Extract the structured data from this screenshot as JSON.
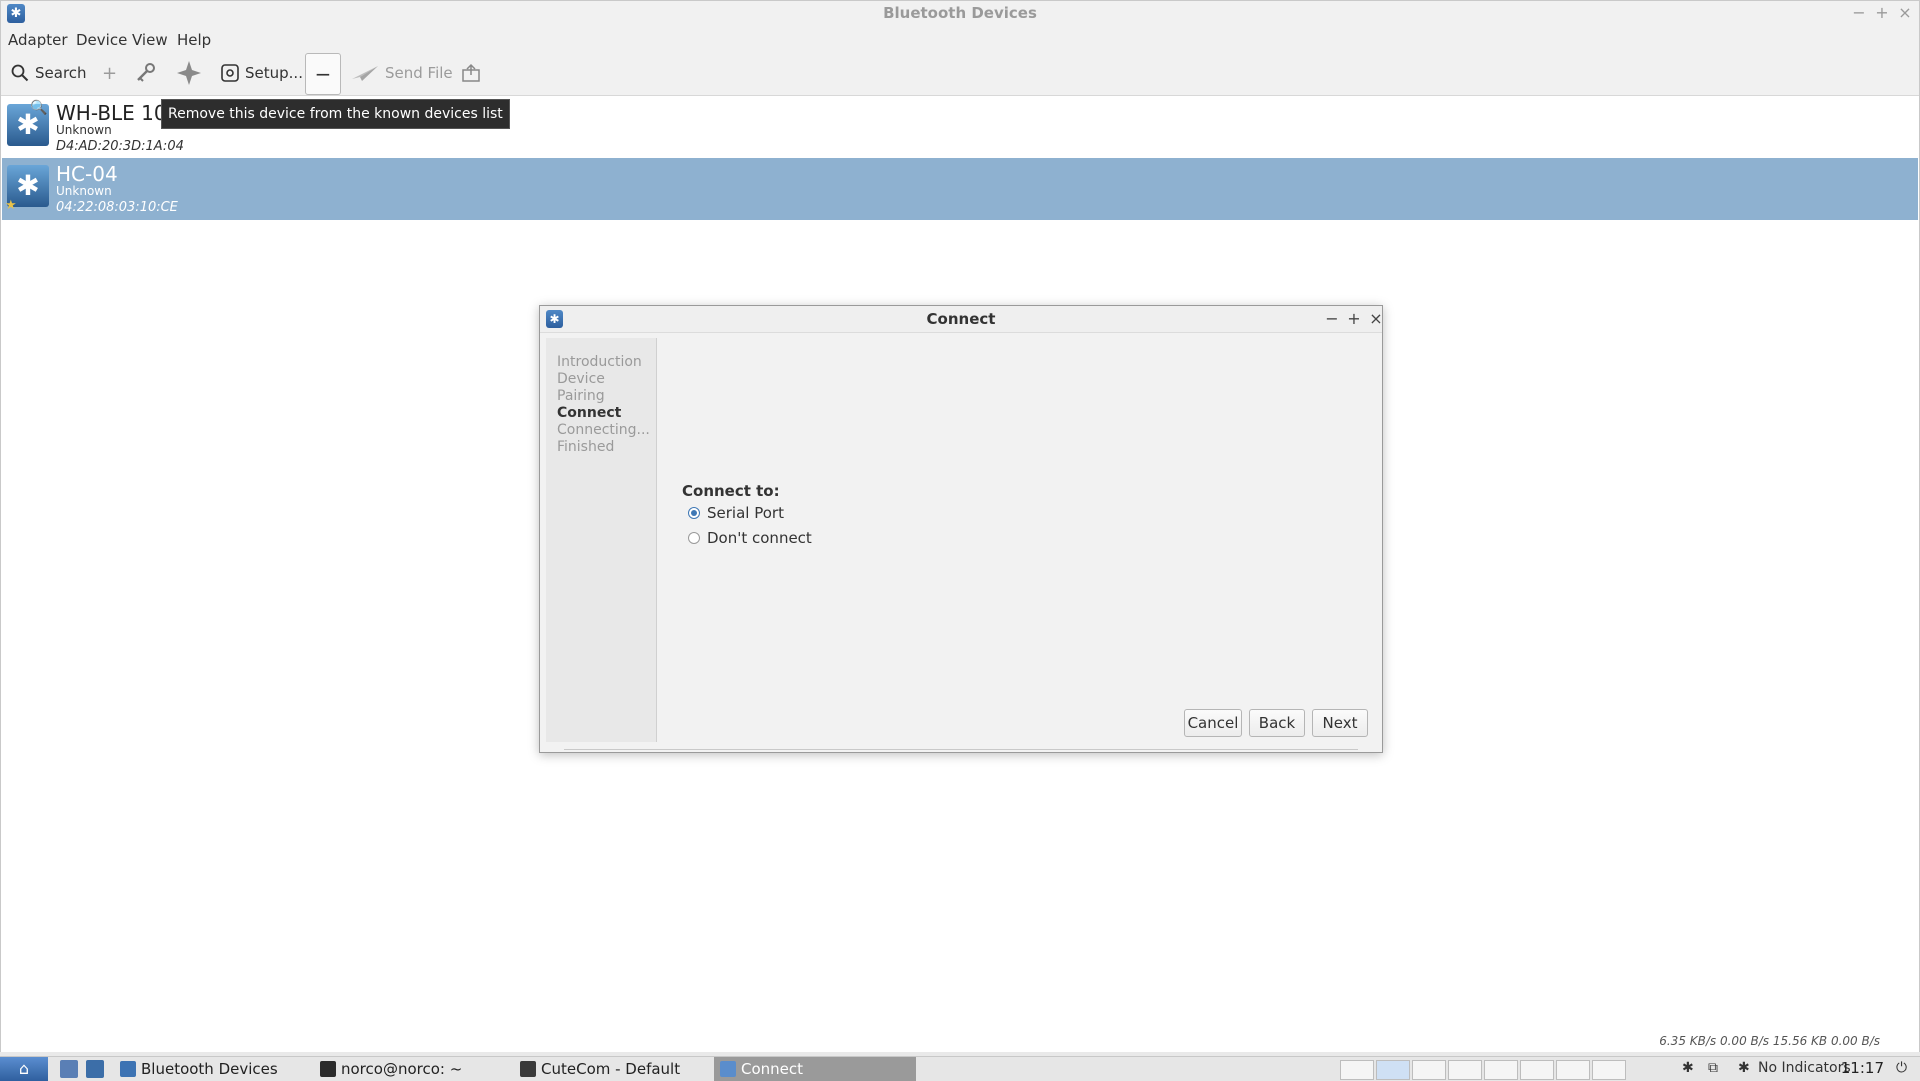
{
  "window": {
    "title": "Bluetooth Devices",
    "controls": [
      "−",
      "+",
      "×"
    ]
  },
  "menu": [
    "Adapter",
    "Device",
    "View",
    "Help"
  ],
  "toolbar": {
    "search": "Search",
    "add": "+",
    "setup": "Setup...",
    "remove": "−",
    "send_file": "Send File"
  },
  "devices": [
    {
      "name": "WH-BLE 10",
      "type": "Unknown",
      "address": "D4:AD:20:3D:1A:04"
    },
    {
      "name": "HC-04",
      "type": "Unknown",
      "address": "04:22:08:03:10:CE"
    }
  ],
  "tooltip": "Remove this device from the known devices list",
  "dialog": {
    "title": "Connect",
    "steps": [
      "Introduction",
      "Device",
      "Pairing",
      "Connect",
      "Connecting...",
      "Finished"
    ],
    "active_step": "Connect",
    "connect_label": "Connect to:",
    "options": [
      {
        "label": "Serial Port",
        "selected": true
      },
      {
        "label": "Don't connect",
        "selected": false
      }
    ],
    "buttons": {
      "cancel": "Cancel",
      "back": "Back",
      "next": "Next"
    }
  },
  "taskbar": {
    "tasks": [
      "Bluetooth Devices",
      "norco@norco: ~",
      "CuteCom - Default",
      "Connect"
    ],
    "network_speed": "6.35 KB/s   0.00 B/s   15.56 KB   0.00 B/s",
    "indicators": "No Indicators",
    "clock": "11:17"
  },
  "colors": {
    "selection": "#8eb1d0",
    "accent": "#3f78b5"
  }
}
